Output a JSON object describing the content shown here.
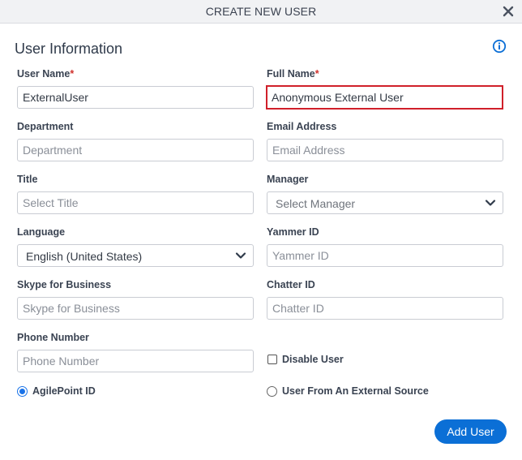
{
  "dialog": {
    "title": "CREATE NEW USER",
    "close_icon": "close-icon",
    "section_title": "User Information",
    "info_icon": "info-icon",
    "required_marker": "*"
  },
  "fields": {
    "user_name": {
      "label": "User Name",
      "required": true,
      "value": "ExternalUser",
      "placeholder": ""
    },
    "full_name": {
      "label": "Full Name",
      "required": true,
      "value": "Anonymous External User",
      "placeholder": ""
    },
    "department": {
      "label": "Department",
      "value": "",
      "placeholder": "Department"
    },
    "email": {
      "label": "Email Address",
      "value": "",
      "placeholder": "Email Address"
    },
    "title": {
      "label": "Title",
      "value": "",
      "placeholder": "Select Title"
    },
    "manager": {
      "label": "Manager",
      "selected": "Select Manager"
    },
    "language": {
      "label": "Language",
      "selected": "English (United States)"
    },
    "yammer": {
      "label": "Yammer ID",
      "value": "",
      "placeholder": "Yammer ID"
    },
    "skype": {
      "label": "Skype for Business",
      "value": "",
      "placeholder": "Skype for Business"
    },
    "chatter": {
      "label": "Chatter ID",
      "value": "",
      "placeholder": "Chatter ID"
    },
    "phone": {
      "label": "Phone Number",
      "value": "",
      "placeholder": "Phone Number"
    }
  },
  "options": {
    "disable_user": {
      "label": "Disable User",
      "checked": false
    },
    "agilepoint_id": {
      "label": "AgilePoint ID",
      "selected": true
    },
    "external_source": {
      "label": "User From An External Source",
      "selected": false
    }
  },
  "actions": {
    "add_user": "Add User"
  },
  "colors": {
    "accent": "#0b6fd6",
    "highlight_border": "#d0202a",
    "required": "#d0312d"
  }
}
